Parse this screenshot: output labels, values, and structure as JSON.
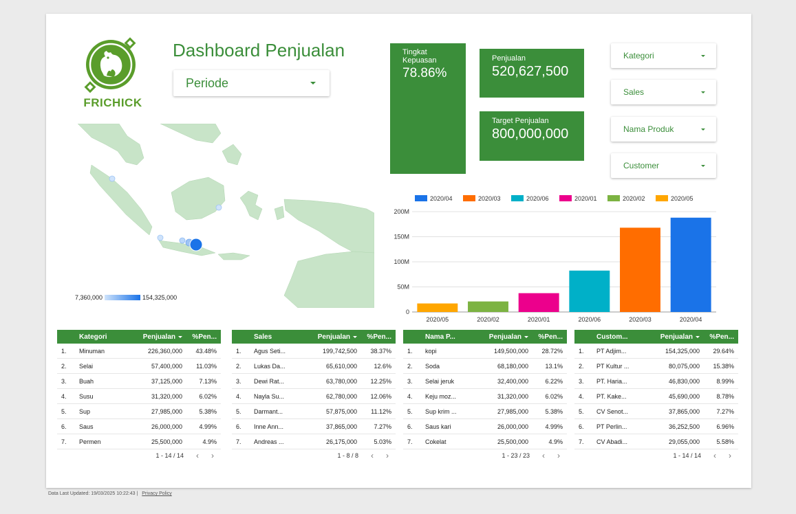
{
  "header": {
    "logo_text": "FRICHICK",
    "title": "Dashboard Penjualan",
    "periode_label": "Periode"
  },
  "kpis": {
    "satisfaction": {
      "label": "Tingkat Kepuasan",
      "value": "78.86%"
    },
    "sales": {
      "label": "Penjualan",
      "value": "520,627,500"
    },
    "target": {
      "label": "Target Penjualan",
      "value": "800,000,000"
    }
  },
  "filters": [
    "Kategori",
    "Sales",
    "Nama Produk",
    "Customer"
  ],
  "map": {
    "legend_min": "7,360,000",
    "legend_max": "154,325,000"
  },
  "chart_data": {
    "type": "bar",
    "categories": [
      "2020/05",
      "2020/02",
      "2020/01",
      "2020/06",
      "2020/03",
      "2020/04"
    ],
    "values": [
      17000000,
      21000000,
      37500000,
      82500000,
      168000000,
      188000000
    ],
    "colors": [
      "#ffa600",
      "#7cb342",
      "#ec008c",
      "#00b0c8",
      "#ff6d00",
      "#1a73e8"
    ],
    "legend": [
      {
        "name": "2020/04",
        "color": "#1a73e8"
      },
      {
        "name": "2020/03",
        "color": "#ff6d00"
      },
      {
        "name": "2020/06",
        "color": "#00b0c8"
      },
      {
        "name": "2020/01",
        "color": "#ec008c"
      },
      {
        "name": "2020/02",
        "color": "#7cb342"
      },
      {
        "name": "2020/05",
        "color": "#ffa600"
      }
    ],
    "ylim": [
      0,
      200000000
    ],
    "yticks": [
      0,
      50000000,
      100000000,
      150000000,
      200000000
    ],
    "ytick_labels": [
      "0",
      "50M",
      "100M",
      "150M",
      "200M"
    ],
    "legend_position": "top",
    "grid": true
  },
  "tables": [
    {
      "headers": [
        "Kategori",
        "Penjualan",
        "%Pen..."
      ],
      "rows": [
        [
          "1.",
          "Minuman",
          "226,360,000",
          "43.48%"
        ],
        [
          "2.",
          "Selai",
          "57,400,000",
          "11.03%"
        ],
        [
          "3.",
          "Buah",
          "37,125,000",
          "7.13%"
        ],
        [
          "4.",
          "Susu",
          "31,320,000",
          "6.02%"
        ],
        [
          "5.",
          "Sup",
          "27,985,000",
          "5.38%"
        ],
        [
          "6.",
          "Saus",
          "26,000,000",
          "4.99%"
        ],
        [
          "7.",
          "Permen",
          "25,500,000",
          "4.9%"
        ]
      ],
      "pager": "1 - 14 / 14"
    },
    {
      "headers": [
        "Sales",
        "Penjualan",
        "%Pen..."
      ],
      "rows": [
        [
          "1.",
          "Agus Seti...",
          "199,742,500",
          "38.37%"
        ],
        [
          "2.",
          "Lukas Da...",
          "65,610,000",
          "12.6%"
        ],
        [
          "3.",
          "Dewi Rat...",
          "63,780,000",
          "12.25%"
        ],
        [
          "4.",
          "Nayla Su...",
          "62,780,000",
          "12.06%"
        ],
        [
          "5.",
          "Darmant...",
          "57,875,000",
          "11.12%"
        ],
        [
          "6.",
          "Inne Ann...",
          "37,865,000",
          "7.27%"
        ],
        [
          "7.",
          "Andreas ...",
          "26,175,000",
          "5.03%"
        ]
      ],
      "pager": "1 - 8 / 8"
    },
    {
      "headers": [
        "Nama P...",
        "Penjualan",
        "%Pen..."
      ],
      "rows": [
        [
          "1.",
          "kopi",
          "149,500,000",
          "28.72%"
        ],
        [
          "2.",
          "Soda",
          "68,180,000",
          "13.1%"
        ],
        [
          "3.",
          "Selai jeruk",
          "32,400,000",
          "6.22%"
        ],
        [
          "4.",
          "Keju moz...",
          "31,320,000",
          "6.02%"
        ],
        [
          "5.",
          "Sup krim ...",
          "27,985,000",
          "5.38%"
        ],
        [
          "6.",
          "Saus kari",
          "26,000,000",
          "4.99%"
        ],
        [
          "7.",
          "Cokelat",
          "25,500,000",
          "4.9%"
        ]
      ],
      "pager": "1 - 23 / 23"
    },
    {
      "headers": [
        "Custom...",
        "Penjualan",
        "%Pen..."
      ],
      "rows": [
        [
          "1.",
          "PT Adjim...",
          "154,325,000",
          "29.64%"
        ],
        [
          "2.",
          "PT Kultur ...",
          "80,075,000",
          "15.38%"
        ],
        [
          "3.",
          "PT. Haria...",
          "46,830,000",
          "8.99%"
        ],
        [
          "4.",
          "PT. Kake...",
          "45,690,000",
          "8.78%"
        ],
        [
          "5.",
          "CV Senot...",
          "37,865,000",
          "7.27%"
        ],
        [
          "6.",
          "PT Perlin...",
          "36,252,500",
          "6.96%"
        ],
        [
          "7.",
          "CV Abadi...",
          "29,055,000",
          "5.58%"
        ]
      ],
      "pager": "1 - 14 / 14"
    }
  ],
  "footer": {
    "updated": "Data Last Updated: 19/03/2025 10:22:43",
    "separator": "|",
    "privacy": "Privacy Policy"
  }
}
